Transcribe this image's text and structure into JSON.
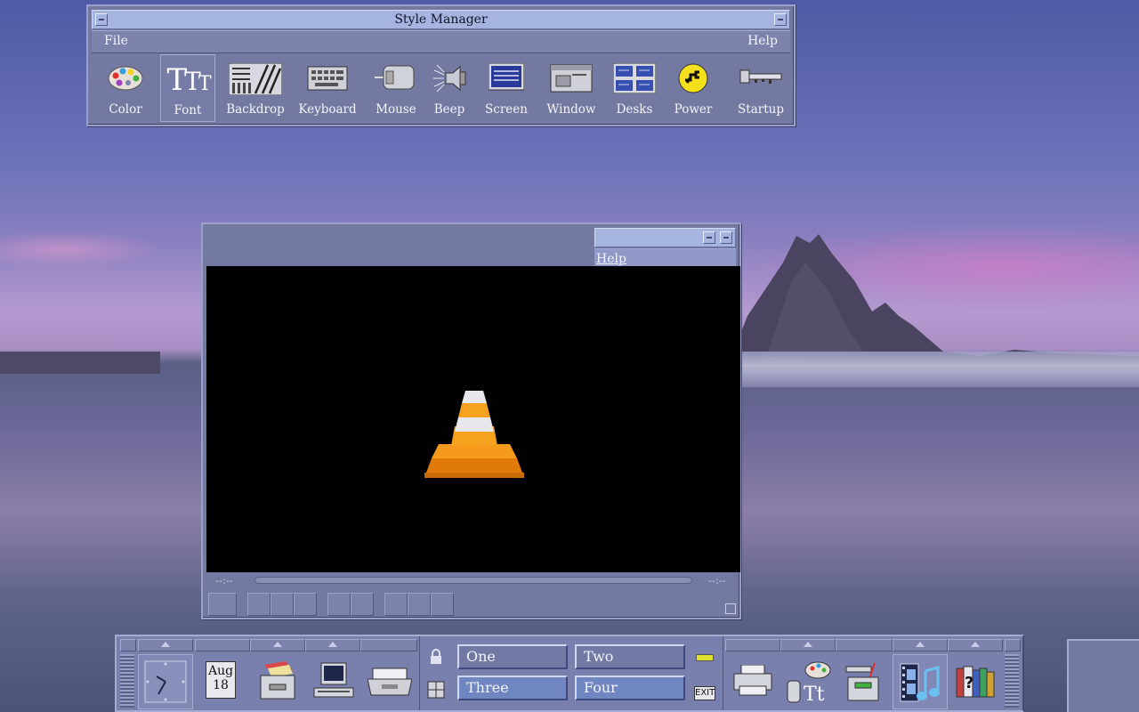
{
  "style_manager": {
    "title": "Style Manager",
    "menu": {
      "file": "File",
      "help": "Help"
    },
    "tools": [
      {
        "id": "color",
        "label": "Color",
        "icon": "palette-icon"
      },
      {
        "id": "font",
        "label": "Font",
        "icon": "font-icon",
        "selected": true
      },
      {
        "id": "backdrop",
        "label": "Backdrop",
        "icon": "backdrop-icon"
      },
      {
        "id": "keyboard",
        "label": "Keyboard",
        "icon": "keyboard-icon"
      },
      {
        "id": "mouse",
        "label": "Mouse",
        "icon": "mouse-icon"
      },
      {
        "id": "beep",
        "label": "Beep",
        "icon": "speaker-icon"
      },
      {
        "id": "screen",
        "label": "Screen",
        "icon": "screen-icon"
      },
      {
        "id": "window",
        "label": "Window",
        "icon": "window-icon"
      },
      {
        "id": "desks",
        "label": "Desks",
        "icon": "desks-icon"
      },
      {
        "id": "power",
        "label": "Power",
        "icon": "power-plug-icon"
      },
      {
        "id": "startup",
        "label": "Startup",
        "icon": "key-icon"
      }
    ],
    "font_glyph": "TTT"
  },
  "vlc": {
    "menu_help": "Help",
    "elapsed": "--:--",
    "remaining": "--:--"
  },
  "front_panel": {
    "calendar": {
      "month": "Aug",
      "day": "18"
    },
    "workspaces": [
      "One",
      "Two",
      "Three",
      "Four"
    ],
    "exit_label": "EXIT"
  },
  "colors": {
    "window_bg": "#7479a2",
    "title_active": "#a6b4e0",
    "workspace_active": "#6f86c0"
  }
}
